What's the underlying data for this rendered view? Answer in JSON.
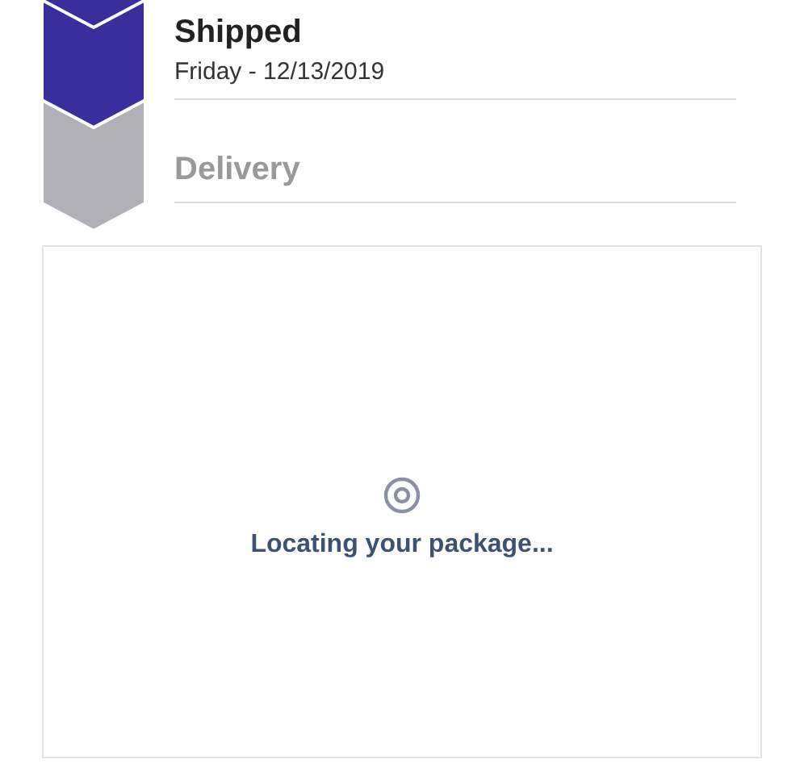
{
  "steps": [
    {
      "title": "Shipped",
      "date": "Friday - 12/13/2019",
      "completed": true
    },
    {
      "title": "Delivery",
      "completed": false
    }
  ],
  "map_panel": {
    "message": "Locating your package..."
  }
}
